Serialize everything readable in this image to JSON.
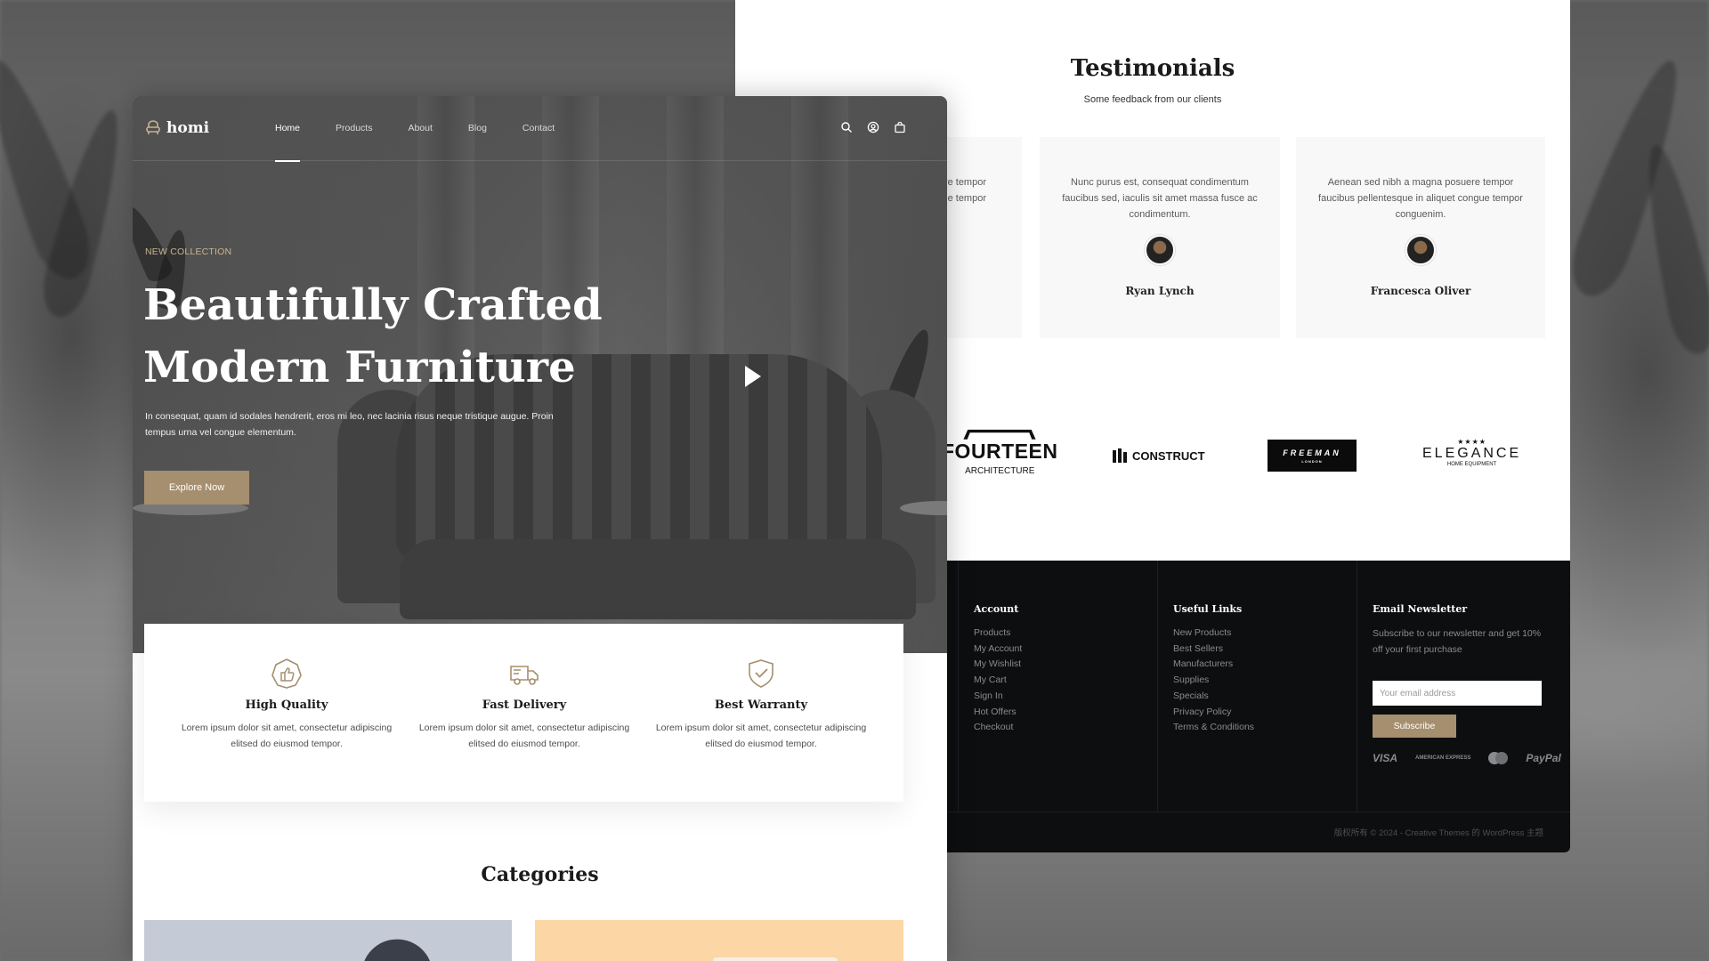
{
  "nav": {
    "brand": "homi",
    "menu": [
      "Home",
      "Products",
      "About",
      "Blog",
      "Contact"
    ],
    "active": "Home",
    "icons": [
      "search-icon",
      "user-icon",
      "cart-icon"
    ]
  },
  "hero": {
    "eyebrow": "NEW COLLECTION",
    "title_line1": "Beautifully Crafted",
    "title_line2": "Modern Furniture",
    "text": "In consequat, quam id sodales hendrerit, eros mi leo, nec lacinia risus neque tristique augue. Proin tempus urna vel congue elementum.",
    "button": "Explore Now"
  },
  "features": [
    {
      "icon": "thumbs-up-badge-icon",
      "title": "High Quality",
      "text": "Lorem ipsum dolor sit amet, consectetur adipiscing elitsed do eiusmod tempor."
    },
    {
      "icon": "delivery-truck-icon",
      "title": "Fast Delivery",
      "text": "Lorem ipsum dolor sit amet, consectetur adipiscing elitsed do eiusmod tempor."
    },
    {
      "icon": "shield-check-icon",
      "title": "Best Warranty",
      "text": "Lorem ipsum dolor sit amet, consectetur adipiscing elitsed do eiusmod tempor."
    }
  ],
  "categories": {
    "title": "Categories"
  },
  "testimonials": {
    "title": "Testimonials",
    "subtitle": "Some feedback from our clients",
    "partial_card": {
      "line1": "re tempor",
      "line2": "ngue tempor"
    },
    "cards": [
      {
        "quote": "Nunc purus est, consequat condimentum faucibus sed, iaculis sit amet massa fusce ac condimentum.",
        "name": "Ryan Lynch"
      },
      {
        "quote": "Aenean sed nibh a magna posuere tempor faucibus pellentesque in aliquet congue tempor conguenim.",
        "name": "Francesca Oliver"
      }
    ]
  },
  "brands": {
    "fourteen": {
      "big": "FOURTEEN",
      "small": "ARCHITECTURE"
    },
    "construct": "CONSTRUCT",
    "freeman": {
      "big": "FREEMAN",
      "small": "LONDON"
    },
    "elegance": {
      "stars": "★★★★",
      "big": "ELEGANCE",
      "small": "HOME EQUIPMENT"
    }
  },
  "footer": {
    "account": {
      "heading": "Account",
      "links": [
        "Products",
        "My Account",
        "My Wishlist",
        "My Cart",
        "Sign In",
        "Hot Offers",
        "Checkout"
      ]
    },
    "useful": {
      "heading": "Useful Links",
      "links": [
        "New Products",
        "Best Sellers",
        "Manufacturers",
        "Supplies",
        "Specials",
        "Privacy Policy",
        "Terms & Conditions"
      ]
    },
    "newsletter": {
      "heading": "Email Newsletter",
      "text": "Subscribe to our newsletter and get 10% off your first purchase",
      "placeholder": "Your email address",
      "button": "Subscribe",
      "payments": {
        "visa": "VISA",
        "amex": "AMERICAN EXPRESS",
        "paypal": "PayPal"
      }
    },
    "copyright": "版权所有 © 2024 - Creative Themes 的 WordPress 主题"
  },
  "colors": {
    "accent": "#a58f6f",
    "eyebrow": "#c9b38f",
    "footer_bg": "#0d0e10"
  }
}
